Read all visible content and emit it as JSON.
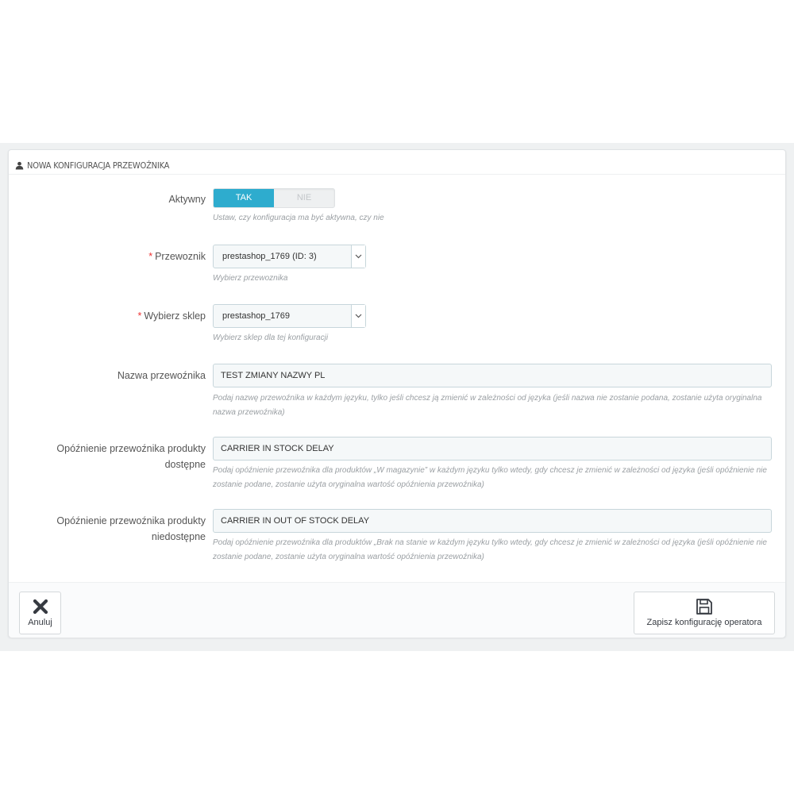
{
  "panel": {
    "title": "NOWA KONFIGURACJA PRZEWOŹNIKA",
    "title_icon": "user-icon"
  },
  "form": {
    "active": {
      "label": "Aktywny",
      "on_label": "TAK",
      "off_label": "NIE",
      "value": "TAK",
      "help": "Ustaw, czy konfiguracja ma być aktywna, czy nie"
    },
    "carrier": {
      "required_mark": "*",
      "label": "Przewoznik",
      "value": "prestashop_1769 (ID: 3)",
      "help": "Wybierz przewoznika"
    },
    "shop": {
      "required_mark": "*",
      "label": "Wybierz sklep",
      "value": "prestashop_1769",
      "help": "Wybierz sklep dla tej konfiguracji"
    },
    "carrier_name": {
      "label": "Nazwa przewoźnika",
      "value": "TEST ZMIANY NAZWY PL",
      "help": "Podaj nazwę przewoźnika w każdym języku, tylko jeśli chcesz ją zmienić w zależności od języka (jeśli nazwa nie zostanie podana, zostanie użyta oryginalna nazwa przewoźnika)"
    },
    "delay_in_stock": {
      "label_line1": "Opóźnienie przewoźnika produkty",
      "label_line2": "dostępne",
      "value": "CARRIER IN STOCK DELAY",
      "help": "Podaj opóźnienie przewoźnika dla produktów „W magazynie” w każdym języku tylko wtedy, gdy chcesz je zmienić w zależności od języka (jeśli opóźnienie nie zostanie podane, zostanie użyta oryginalna wartość opóźnienia przewoźnika)"
    },
    "delay_out_of_stock": {
      "label_line1": "Opóźnienie przewoźnika produkty",
      "label_line2": "niedostępne",
      "value": "CARRIER IN OUT OF STOCK DELAY",
      "help": "Podaj opóźnienie przewoźnika dla produktów „Brak na stanie w każdym języku tylko wtedy, gdy chcesz je zmienić w zależności od języka (jeśli opóźnienie nie zostanie podane, zostanie użyta oryginalna wartość opóźnienia przewoźnika)"
    }
  },
  "footer": {
    "cancel_label": "Anuluj",
    "cancel_icon": "close-icon",
    "save_label": "Zapisz konfigurację operatora",
    "save_icon": "save-icon"
  },
  "colors": {
    "accent": "#2eacce",
    "required": "#e33333",
    "background": "#eff1f2"
  }
}
